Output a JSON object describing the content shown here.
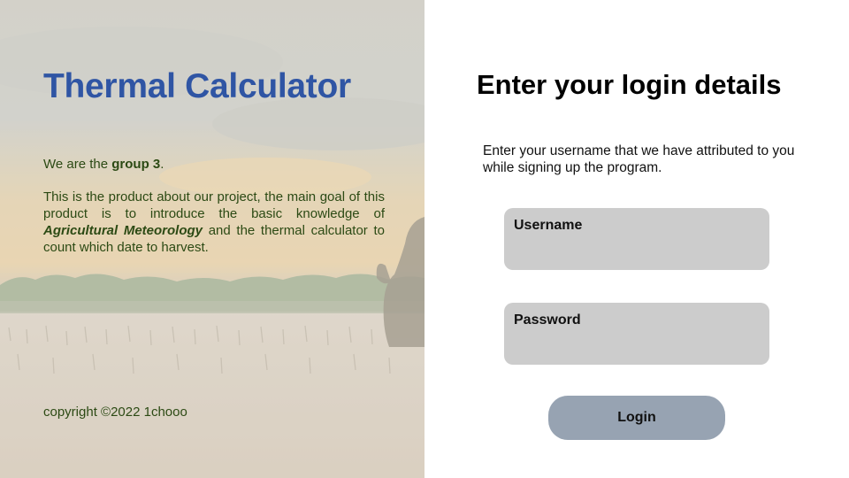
{
  "left": {
    "title": "Thermal Calculator",
    "intro_prefix": "We are the ",
    "intro_group": "group 3",
    "intro_suffix": ".",
    "desc_part1": "This is the product about our project, the main goal of this product is to introduce the basic knowledge of ",
    "desc_highlight": "Agricultural Meteorology",
    "desc_part2": " and the thermal calculator to count which date to harvest.",
    "copyright": "copyright ©2022 1chooo"
  },
  "right": {
    "title": "Enter your login details",
    "description": "Enter your username that we have attributed to you while signing up the program.",
    "username_label": "Username",
    "username_value": "",
    "password_label": "Password",
    "password_value": "",
    "login_label": "Login"
  },
  "colors": {
    "title": "#2f55a4",
    "body_text": "#2c4a14",
    "field_bg": "#cccccc",
    "button_bg": "#97a3b2"
  }
}
